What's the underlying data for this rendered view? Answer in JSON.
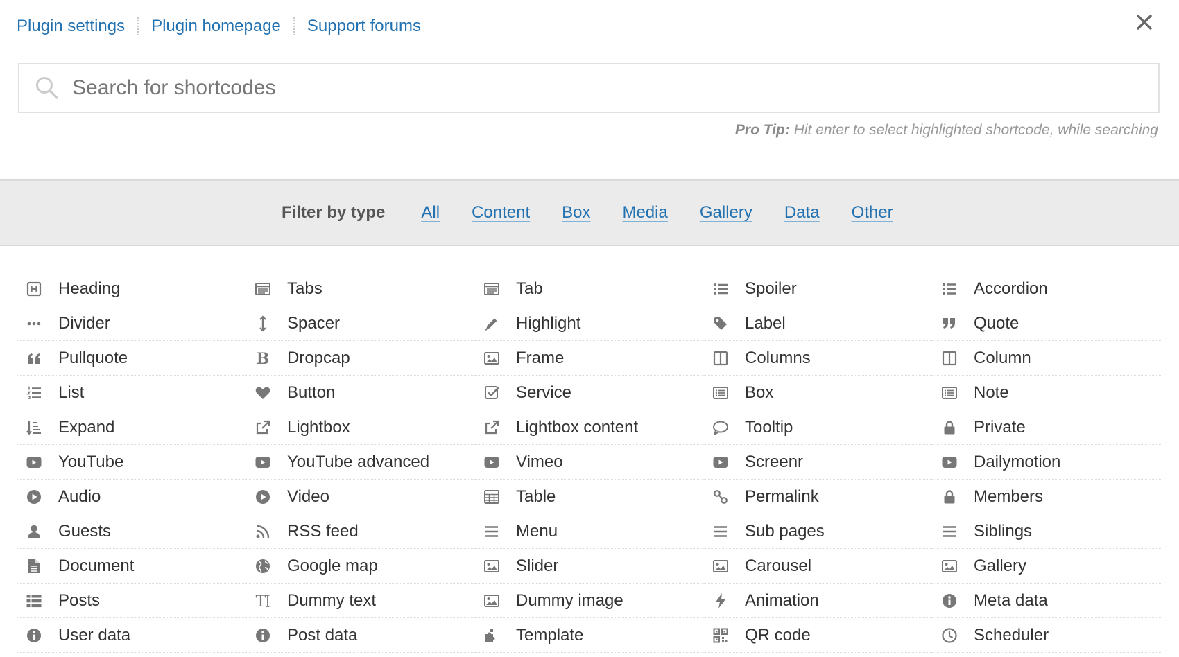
{
  "top_links": [
    "Plugin settings",
    "Plugin homepage",
    "Support forums"
  ],
  "search": {
    "placeholder": "Search for shortcodes"
  },
  "pro_tip": {
    "label": "Pro Tip:",
    "text": "Hit enter to select highlighted shortcode, while searching"
  },
  "filter": {
    "label": "Filter by type",
    "types": [
      "All",
      "Content",
      "Box",
      "Media",
      "Gallery",
      "Data",
      "Other"
    ]
  },
  "colors": {
    "link": "#2271b1",
    "icon": "#777777",
    "filter_bg": "#ebebeb"
  },
  "shortcodes": [
    {
      "label": "Heading",
      "icon": "heading-icon"
    },
    {
      "label": "Tabs",
      "icon": "tabs-icon"
    },
    {
      "label": "Tab",
      "icon": "tab-icon"
    },
    {
      "label": "Spoiler",
      "icon": "list-ul-icon"
    },
    {
      "label": "Accordion",
      "icon": "list-icon"
    },
    {
      "label": "Divider",
      "icon": "ellipsis-icon"
    },
    {
      "label": "Spacer",
      "icon": "arrows-v-icon"
    },
    {
      "label": "Highlight",
      "icon": "pencil-icon"
    },
    {
      "label": "Label",
      "icon": "tag-icon"
    },
    {
      "label": "Quote",
      "icon": "quote-right-icon"
    },
    {
      "label": "Pullquote",
      "icon": "quote-left-icon"
    },
    {
      "label": "Dropcap",
      "icon": "bold-icon"
    },
    {
      "label": "Frame",
      "icon": "picture-icon"
    },
    {
      "label": "Columns",
      "icon": "columns-icon"
    },
    {
      "label": "Column",
      "icon": "columns-icon"
    },
    {
      "label": "List",
      "icon": "list-ol-icon"
    },
    {
      "label": "Button",
      "icon": "heart-icon"
    },
    {
      "label": "Service",
      "icon": "check-square-icon"
    },
    {
      "label": "Box",
      "icon": "list-alt-icon"
    },
    {
      "label": "Note",
      "icon": "list-alt-icon"
    },
    {
      "label": "Expand",
      "icon": "sort-amount-icon"
    },
    {
      "label": "Lightbox",
      "icon": "external-link-icon"
    },
    {
      "label": "Lightbox content",
      "icon": "external-link-icon"
    },
    {
      "label": "Tooltip",
      "icon": "comment-icon"
    },
    {
      "label": "Private",
      "icon": "lock-icon"
    },
    {
      "label": "YouTube",
      "icon": "youtube-play-icon"
    },
    {
      "label": "YouTube advanced",
      "icon": "youtube-play-icon"
    },
    {
      "label": "Vimeo",
      "icon": "youtube-play-icon"
    },
    {
      "label": "Screenr",
      "icon": "youtube-play-icon"
    },
    {
      "label": "Dailymotion",
      "icon": "youtube-play-icon"
    },
    {
      "label": "Audio",
      "icon": "play-circle-icon"
    },
    {
      "label": "Video",
      "icon": "play-circle-icon"
    },
    {
      "label": "Table",
      "icon": "table-icon"
    },
    {
      "label": "Permalink",
      "icon": "link-icon"
    },
    {
      "label": "Members",
      "icon": "lock-icon"
    },
    {
      "label": "Guests",
      "icon": "user-icon"
    },
    {
      "label": "RSS feed",
      "icon": "rss-icon"
    },
    {
      "label": "Menu",
      "icon": "bars-icon"
    },
    {
      "label": "Sub pages",
      "icon": "bars-icon"
    },
    {
      "label": "Siblings",
      "icon": "bars-icon"
    },
    {
      "label": "Document",
      "icon": "file-text-icon"
    },
    {
      "label": "Google map",
      "icon": "globe-icon"
    },
    {
      "label": "Slider",
      "icon": "picture-icon"
    },
    {
      "label": "Carousel",
      "icon": "picture-icon"
    },
    {
      "label": "Gallery",
      "icon": "picture-icon"
    },
    {
      "label": "Posts",
      "icon": "th-list-icon"
    },
    {
      "label": "Dummy text",
      "icon": "text-height-icon"
    },
    {
      "label": "Dummy image",
      "icon": "picture-icon"
    },
    {
      "label": "Animation",
      "icon": "bolt-icon"
    },
    {
      "label": "Meta data",
      "icon": "info-circle-icon"
    },
    {
      "label": "User data",
      "icon": "info-circle-icon"
    },
    {
      "label": "Post data",
      "icon": "info-circle-icon"
    },
    {
      "label": "Template",
      "icon": "puzzle-piece-icon"
    },
    {
      "label": "QR code",
      "icon": "qrcode-icon"
    },
    {
      "label": "Scheduler",
      "icon": "clock-icon"
    }
  ]
}
